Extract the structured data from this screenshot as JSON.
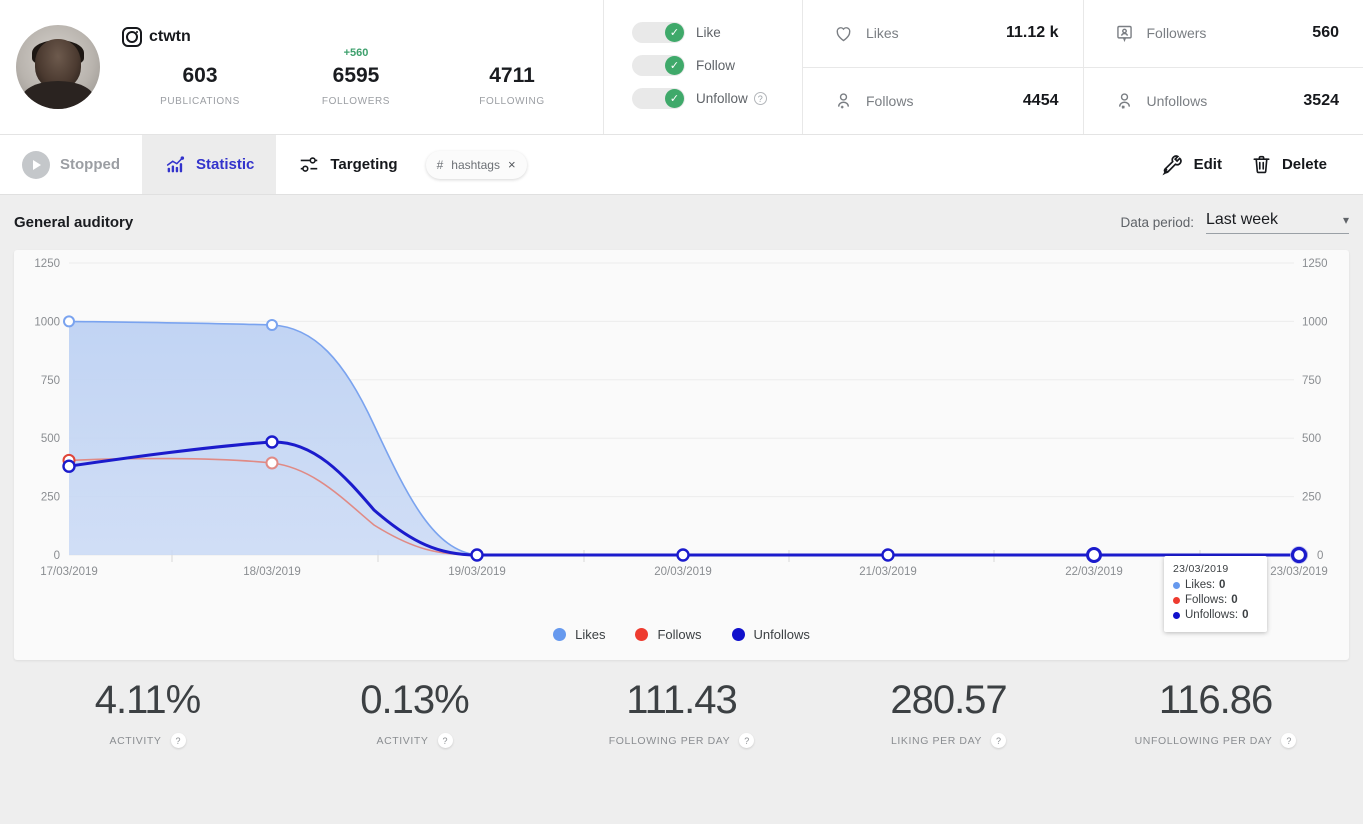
{
  "profile": {
    "handle": "ctwtn",
    "platform_icon": "instagram-icon",
    "stats": [
      {
        "value": "603",
        "label": "PUBLICATIONS",
        "delta": ""
      },
      {
        "value": "6595",
        "label": "FOLLOWERS",
        "delta": "+560"
      },
      {
        "value": "4711",
        "label": "FOLLOWING",
        "delta": ""
      }
    ]
  },
  "toggles": [
    {
      "label": "Like",
      "on": true,
      "help": false
    },
    {
      "label": "Follow",
      "on": true,
      "help": false
    },
    {
      "label": "Unfollow",
      "on": true,
      "help": true
    }
  ],
  "metrics": [
    {
      "icon": "heart-icon",
      "label": "Likes",
      "value": "11.12 k"
    },
    {
      "icon": "user-plus-icon",
      "label": "Follows",
      "value": "4454"
    },
    {
      "icon": "contact-card-icon",
      "label": "Followers",
      "value": "560"
    },
    {
      "icon": "user-minus-icon",
      "label": "Unfollows",
      "value": "3524"
    }
  ],
  "tabs": [
    {
      "label": "Stopped",
      "icon": "play-icon",
      "active": false
    },
    {
      "label": "Statistic",
      "icon": "bar-chart-icon",
      "active": true
    },
    {
      "label": "Targeting",
      "icon": "sliders-icon",
      "active": false
    }
  ],
  "chip": {
    "label": "hashtags",
    "hash": "#",
    "close": "×"
  },
  "actions": [
    {
      "label": "Edit",
      "icon": "wrench-icon"
    },
    {
      "label": "Delete",
      "icon": "trash-icon"
    }
  ],
  "section": {
    "title": "General auditory",
    "period_label": "Data period:",
    "period_value": "Last week",
    "period_caret": "⌄"
  },
  "tooltip": {
    "date": "23/03/2019",
    "rows": [
      {
        "label": "Likes:",
        "value": "0",
        "color": "#6699ee"
      },
      {
        "label": "Follows:",
        "value": "0",
        "color": "#ee3b2f"
      },
      {
        "label": "Unfollows:",
        "value": "0",
        "color": "#1111cc"
      }
    ]
  },
  "hover_point_label": "0",
  "colors": {
    "likes": "#6699ee",
    "follows": "#e24b40",
    "unfollows": "#1b1bcc",
    "area": "#c2d5f5",
    "accent": "#3333cc",
    "green": "#3fa96a"
  },
  "chart_data": {
    "type": "area",
    "title": "General auditory",
    "xlabel": "",
    "ylabel": "",
    "grid": true,
    "legend_position": "bottom",
    "ylim": [
      0,
      1250
    ],
    "yticks": [
      0,
      250,
      500,
      750,
      1000,
      1250
    ],
    "y2ticks": [
      0,
      250,
      500,
      750,
      1000,
      1250
    ],
    "categories": [
      "17/03/2019",
      "18/03/2019",
      "19/03/2019",
      "20/03/2019",
      "21/03/2019",
      "22/03/2019",
      "23/03/2019"
    ],
    "series": [
      {
        "name": "Likes",
        "color": "#6699ee",
        "values": [
          1000,
          985,
          0,
          0,
          0,
          0,
          0
        ]
      },
      {
        "name": "Follows",
        "color": "#e24b40",
        "values": [
          405,
          390,
          0,
          0,
          0,
          0,
          0
        ]
      },
      {
        "name": "Unfollows",
        "color": "#1b1bcc",
        "values": [
          380,
          440,
          0,
          0,
          0,
          0,
          0
        ]
      }
    ]
  },
  "bottom_stats": [
    {
      "value": "4.11%",
      "label": "ACTIVITY",
      "help": "?"
    },
    {
      "value": "0.13%",
      "label": "ACTIVITY",
      "help": "?"
    },
    {
      "value": "111.43",
      "label": "FOLLOWING PER DAY",
      "help": "?"
    },
    {
      "value": "280.57",
      "label": "LIKING PER DAY",
      "help": "?"
    },
    {
      "value": "116.86",
      "label": "UNFOLLOWING PER DAY",
      "help": "?"
    }
  ]
}
